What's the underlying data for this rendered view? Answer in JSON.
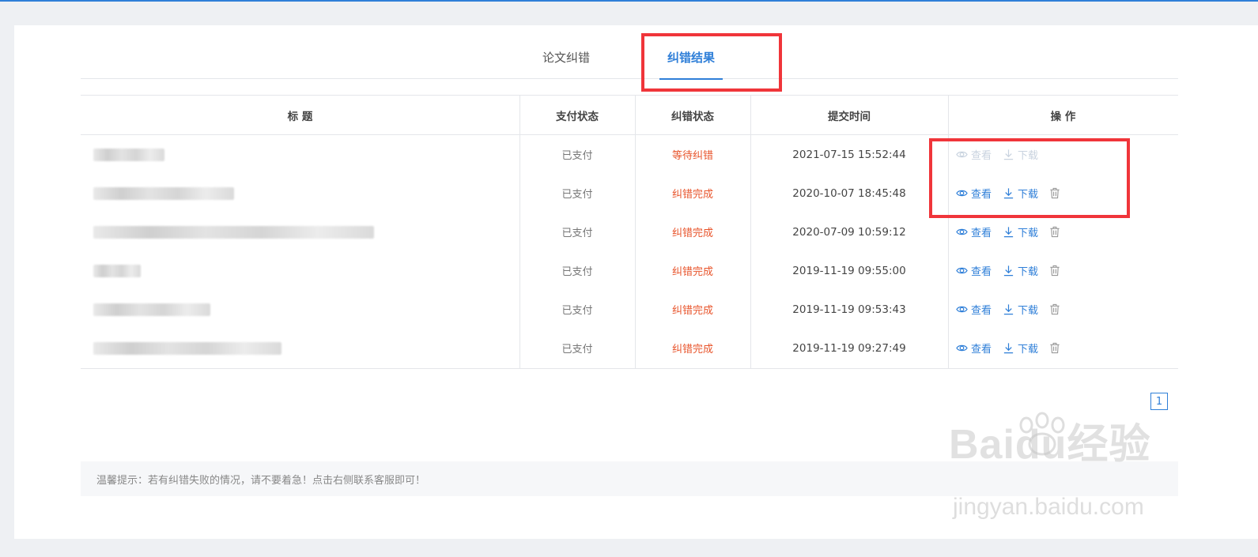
{
  "tabs": [
    {
      "label": "论文纠错"
    },
    {
      "label": "纠错结果"
    }
  ],
  "table": {
    "headers": [
      "标 题",
      "支付状态",
      "纠错状态",
      "提交时间",
      "操 作"
    ],
    "rows": [
      {
        "pay": "已支付",
        "status": "等待纠错",
        "time": "2021-07-15 15:52:44",
        "view": "查看",
        "download": "下载",
        "disabled": true
      },
      {
        "pay": "已支付",
        "status": "纠错完成",
        "time": "2020-10-07 18:45:48",
        "view": "查看",
        "download": "下载",
        "disabled": false
      },
      {
        "pay": "已支付",
        "status": "纠错完成",
        "time": "2020-07-09 10:59:12",
        "view": "查看",
        "download": "下载",
        "disabled": false
      },
      {
        "pay": "已支付",
        "status": "纠错完成",
        "time": "2019-11-19 09:55:00",
        "view": "查看",
        "download": "下载",
        "disabled": false
      },
      {
        "pay": "已支付",
        "status": "纠错完成",
        "time": "2019-11-19 09:53:43",
        "view": "查看",
        "download": "下载",
        "disabled": false
      },
      {
        "pay": "已支付",
        "status": "纠错完成",
        "time": "2019-11-19 09:27:49",
        "view": "查看",
        "download": "下载",
        "disabled": false
      }
    ]
  },
  "pagination": {
    "current": "1"
  },
  "tip": "温馨提示：若有纠错失败的情况，请不要着急！点击右侧联系客服即可！",
  "watermark": {
    "brand": "Baidu经验",
    "url": "jingyan.baidu.com"
  },
  "colors": {
    "accent": "#2f7fd8",
    "status_red": "#e8542b",
    "highlight_box": "#f0353a"
  }
}
